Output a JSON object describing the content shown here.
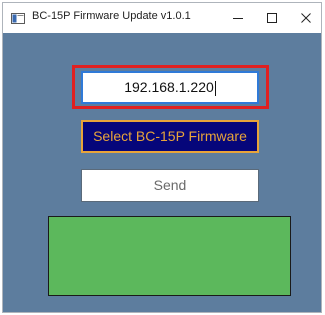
{
  "window": {
    "title": "BC-15P Firmware Update v1.0.1",
    "colors": {
      "client_bg": "#5d7d9e",
      "status_green": "#5cb85c",
      "highlight": "#e02020"
    }
  },
  "controls": {
    "ip_value": "192.168.1.220",
    "select_label": "Select BC-15P Firmware",
    "send_label": "Send"
  }
}
